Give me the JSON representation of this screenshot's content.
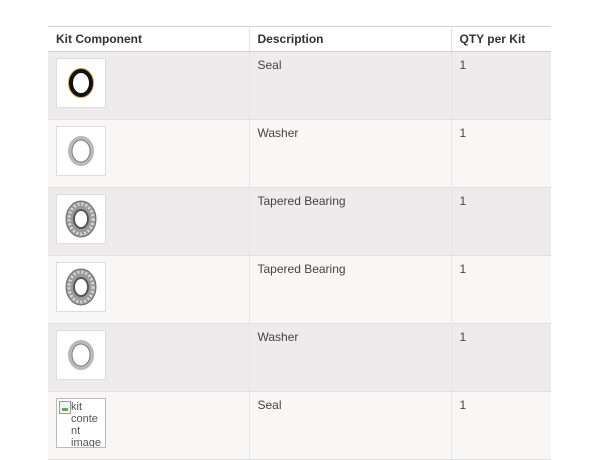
{
  "table": {
    "headers": {
      "component": "Kit Component",
      "description": "Description",
      "qty": "QTY per Kit"
    },
    "rows": [
      {
        "image": "seal-icon",
        "description": "Seal",
        "qty": "1",
        "broken": false
      },
      {
        "image": "washer-icon",
        "description": "Washer",
        "qty": "1",
        "broken": false
      },
      {
        "image": "tapered-bearing-icon",
        "description": "Tapered Bearing",
        "qty": "1",
        "broken": false
      },
      {
        "image": "tapered-bearing-icon",
        "description": "Tapered Bearing",
        "qty": "1",
        "broken": false
      },
      {
        "image": "washer-icon",
        "description": "Washer",
        "qty": "1",
        "broken": false
      },
      {
        "image": "broken-image-icon",
        "description": "Seal",
        "qty": "1",
        "broken": true,
        "alt_text": "kit content image"
      }
    ]
  },
  "colors": {
    "row_odd": "#edebeb",
    "row_even": "#f8f7f6",
    "seal_rubber": "#111111",
    "seal_metal": "#c9a04a",
    "steel": "#a8a8a8"
  }
}
